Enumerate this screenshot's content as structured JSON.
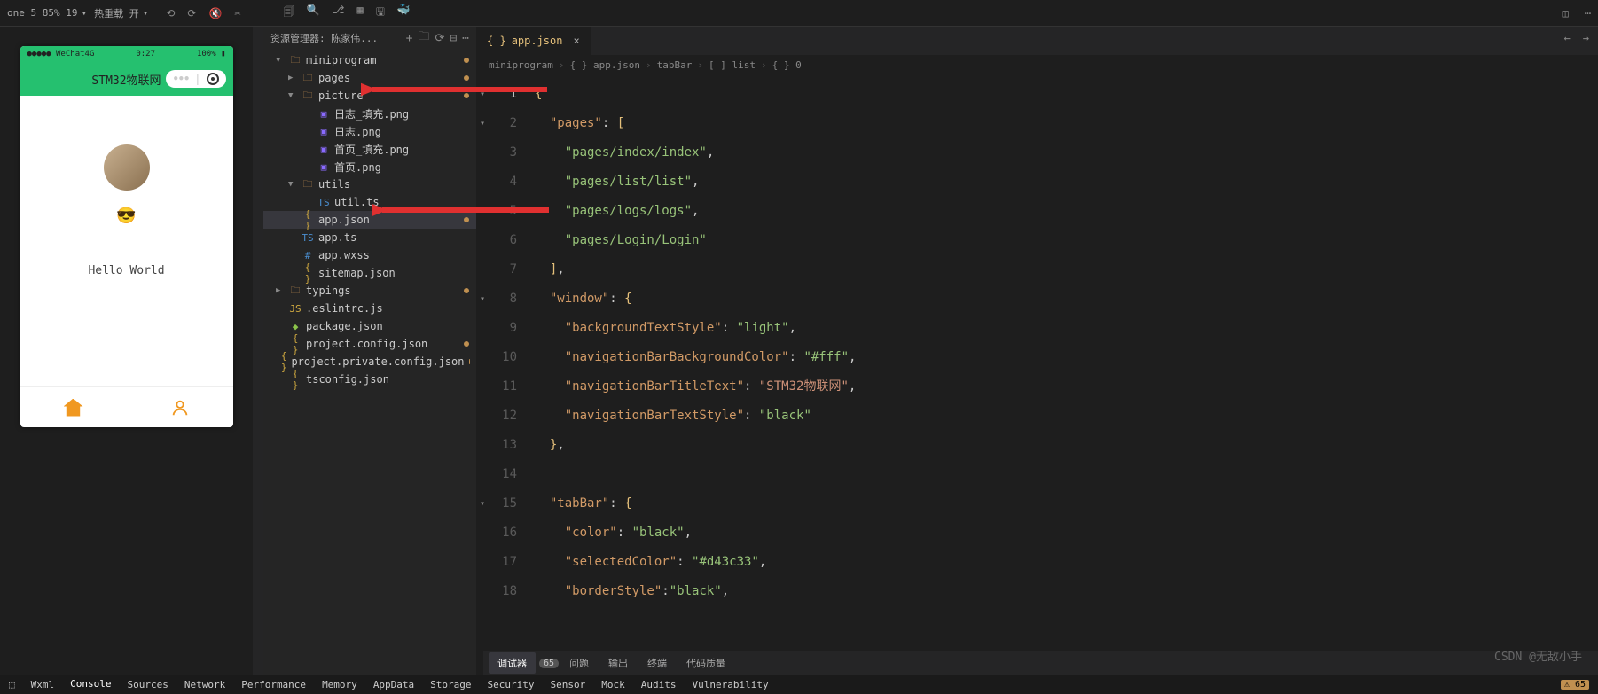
{
  "topBar": {
    "device": "one 5 85% 19",
    "reloadLabel": "热重载 开"
  },
  "simulator": {
    "carrier": "WeChat4G",
    "time": "0:27",
    "battery": "100%",
    "title": "STM32物联网",
    "emoji": "😎",
    "hello": "Hello World"
  },
  "explorer": {
    "header": "资源管理器: 陈家伟...",
    "tree": [
      {
        "type": "folder",
        "name": "miniprogram",
        "indent": 0,
        "open": true,
        "git": true
      },
      {
        "type": "folder",
        "name": "pages",
        "indent": 1,
        "open": false,
        "icon": "folder",
        "git": true
      },
      {
        "type": "folder",
        "name": "picture",
        "indent": 1,
        "open": true,
        "icon": "folder",
        "git": true
      },
      {
        "type": "file",
        "name": "日志_填充.png",
        "indent": 2,
        "icon": "img"
      },
      {
        "type": "file",
        "name": "日志.png",
        "indent": 2,
        "icon": "img"
      },
      {
        "type": "file",
        "name": "首页_填充.png",
        "indent": 2,
        "icon": "img"
      },
      {
        "type": "file",
        "name": "首页.png",
        "indent": 2,
        "icon": "img"
      },
      {
        "type": "folder",
        "name": "utils",
        "indent": 1,
        "open": true,
        "icon": "folder"
      },
      {
        "type": "file",
        "name": "util.ts",
        "indent": 2,
        "icon": "ts"
      },
      {
        "type": "file",
        "name": "app.json",
        "indent": 1,
        "icon": "json",
        "selected": true,
        "git": true
      },
      {
        "type": "file",
        "name": "app.ts",
        "indent": 1,
        "icon": "ts"
      },
      {
        "type": "file",
        "name": "app.wxss",
        "indent": 1,
        "icon": "wxss"
      },
      {
        "type": "file",
        "name": "sitemap.json",
        "indent": 1,
        "icon": "json"
      },
      {
        "type": "folder",
        "name": "typings",
        "indent": 0,
        "open": false,
        "icon": "folder",
        "git": true
      },
      {
        "type": "file",
        "name": ".eslintrc.js",
        "indent": 0,
        "icon": "js"
      },
      {
        "type": "file",
        "name": "package.json",
        "indent": 0,
        "icon": "pkg"
      },
      {
        "type": "file",
        "name": "project.config.json",
        "indent": 0,
        "icon": "json",
        "git": true
      },
      {
        "type": "file",
        "name": "project.private.config.json",
        "indent": 0,
        "icon": "json",
        "git": true
      },
      {
        "type": "file",
        "name": "tsconfig.json",
        "indent": 0,
        "icon": "json"
      }
    ]
  },
  "editor": {
    "tabName": "app.json",
    "breadcrumb": [
      "miniprogram",
      "app.json",
      "tabBar",
      "[ ] list",
      "{ } 0"
    ],
    "code": [
      {
        "n": 1,
        "html": "<span class='brace'>{</span>"
      },
      {
        "n": 2,
        "html": "  <span class='key'>\"pages\"</span><span class='punct'>: </span><span class='bracket'>[</span>"
      },
      {
        "n": 3,
        "html": "    <span class='str'>\"pages/index/index\"</span><span class='punct'>,</span>"
      },
      {
        "n": 4,
        "html": "    <span class='str'>\"pages/list/list\"</span><span class='punct'>,</span>"
      },
      {
        "n": 5,
        "html": "    <span class='str'>\"pages/logs/logs\"</span><span class='punct'>,</span>"
      },
      {
        "n": 6,
        "html": "    <span class='str'>\"pages/Login/Login\"</span>"
      },
      {
        "n": 7,
        "html": "  <span class='bracket'>]</span><span class='punct'>,</span>"
      },
      {
        "n": 8,
        "html": "  <span class='key'>\"window\"</span><span class='punct'>: </span><span class='brace'>{</span>"
      },
      {
        "n": 9,
        "html": "    <span class='key'>\"backgroundTextStyle\"</span><span class='punct'>: </span><span class='str'>\"light\"</span><span class='punct'>,</span>"
      },
      {
        "n": 10,
        "html": "    <span class='key'>\"navigationBarBackgroundColor\"</span><span class='punct'>: </span><span class='str'>\"#fff\"</span><span class='punct'>,</span>"
      },
      {
        "n": 11,
        "html": "    <span class='key'>\"navigationBarTitleText\"</span><span class='punct'>: </span><span class='str2'>\"STM32物联网\"</span><span class='punct'>,</span>"
      },
      {
        "n": 12,
        "html": "    <span class='key'>\"navigationBarTextStyle\"</span><span class='punct'>: </span><span class='str'>\"black\"</span>"
      },
      {
        "n": 13,
        "html": "  <span class='brace'>}</span><span class='punct'>,</span>"
      },
      {
        "n": 14,
        "html": ""
      },
      {
        "n": 15,
        "html": "  <span class='key'>\"tabBar\"</span><span class='punct'>: </span><span class='brace'>{</span>"
      },
      {
        "n": 16,
        "html": "    <span class='key'>\"color\"</span><span class='punct'>: </span><span class='str'>\"black\"</span><span class='punct'>,</span>"
      },
      {
        "n": 17,
        "html": "    <span class='key'>\"selectedColor\"</span><span class='punct'>: </span><span class='str'>\"#d43c33\"</span><span class='punct'>,</span>"
      },
      {
        "n": 18,
        "html": "    <span class='key'>\"borderStyle\"</span><span class='punct'>:</span><span class='str'>\"black\"</span><span class='punct'>,</span>"
      }
    ]
  },
  "bottomTabs": {
    "items": [
      {
        "label": "调试器",
        "active": true,
        "badge": "65"
      },
      {
        "label": "问题"
      },
      {
        "label": "输出"
      },
      {
        "label": "终端"
      },
      {
        "label": "代码质量"
      }
    ]
  },
  "statusBar": {
    "items": [
      "Wxml",
      "Console",
      "Sources",
      "Network",
      "Performance",
      "Memory",
      "AppData",
      "Storage",
      "Security",
      "Sensor",
      "Mock",
      "Audits",
      "Vulnerability"
    ],
    "active": "Console",
    "warnCount": "65"
  },
  "watermark": "CSDN @无敌小手"
}
